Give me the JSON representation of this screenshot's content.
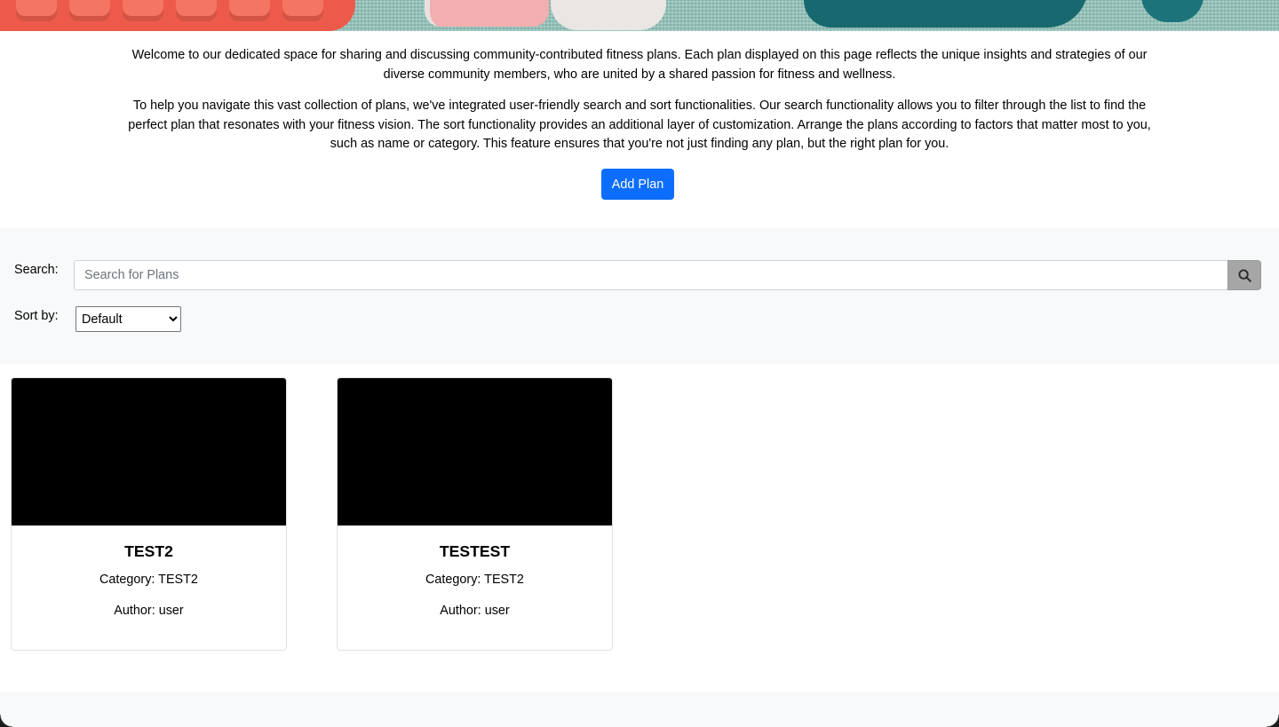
{
  "hero": {
    "image": "fitness-equipment-banner"
  },
  "intro": {
    "paragraph1": "Welcome to our dedicated space for sharing and discussing community-contributed fitness plans. Each plan displayed on this page reflects the unique insights and strategies of our diverse community members, who are united by a shared passion for fitness and wellness.",
    "paragraph2": "To help you navigate this vast collection of plans, we've integrated user-friendly search and sort functionalities. Our search functionality allows you to filter through the list to find the perfect plan that resonates with your fitness vision. The sort functionality provides an additional layer of customization. Arrange the plans according to factors that matter most to you, such as name or category. This feature ensures that you're not just finding any plan, but the right plan for you."
  },
  "actions": {
    "add_plan_label": "Add Plan"
  },
  "search": {
    "label": "Search:",
    "placeholder": "Search for Plans",
    "value": "",
    "button_icon": "search-icon"
  },
  "sort": {
    "label": "Sort by:",
    "selected": "Default"
  },
  "plans": [
    {
      "title": "TEST2",
      "category": "Category: TEST2",
      "author": "Author: user"
    },
    {
      "title": "TESTEST",
      "category": "Category: TEST2",
      "author": "Author: user"
    }
  ],
  "colors": {
    "primary": "#0d6efd",
    "section_bg": "#f8f9fa",
    "search_button": "#a6a6a6"
  }
}
